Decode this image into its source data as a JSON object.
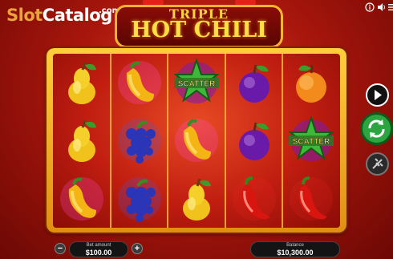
{
  "watermark": {
    "part1": "Slot",
    "part2": "Catalog",
    "suffix": ".com"
  },
  "logo": {
    "line1": "TRIPLE",
    "line2": "HOT CHILI"
  },
  "grid": [
    [
      "pear",
      "pepper",
      "scatter",
      "plum",
      "peach"
    ],
    [
      "pear",
      "grapes",
      "pepper",
      "plum",
      "scatter"
    ],
    [
      "pepper",
      "grapes",
      "pear",
      "chili",
      "chili"
    ]
  ],
  "scatter_text": "SCATTER",
  "bet": {
    "label": "Bet amount",
    "value": "$100.00"
  },
  "balance": {
    "label": "Balance",
    "value": "$10,300.00"
  },
  "icons": {
    "info": "info-icon",
    "sound": "speaker-icon",
    "menu": "menu-icon",
    "play": "play-icon",
    "spin": "spin-arrows-icon",
    "auto": "autoplay-icon",
    "minus": "minus-icon",
    "plus": "plus-icon"
  },
  "colors": {
    "frame": "#f3b12c",
    "spin": "#2ca540",
    "background": "#a8160c"
  }
}
